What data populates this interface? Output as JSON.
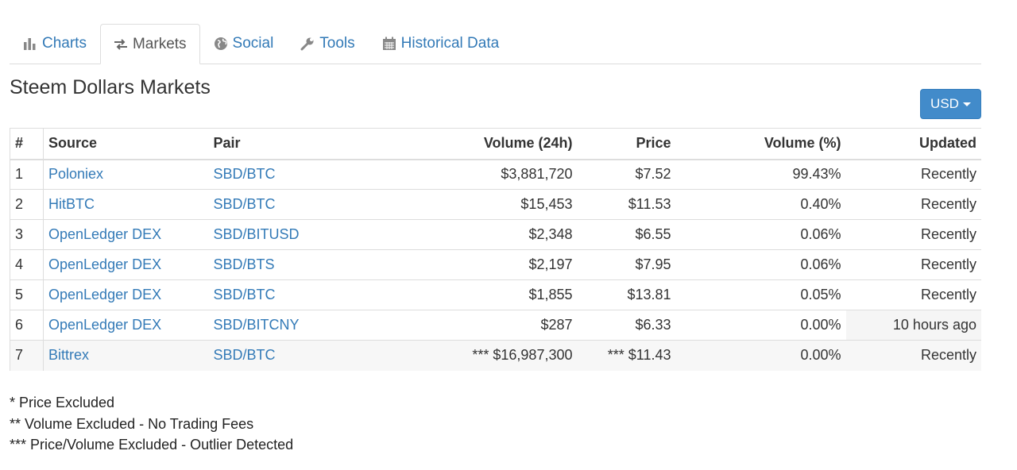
{
  "tabs": [
    {
      "label": "Charts",
      "icon": "bar-chart-icon",
      "active": false
    },
    {
      "label": "Markets",
      "icon": "exchange-arrows-icon",
      "active": true
    },
    {
      "label": "Social",
      "icon": "globe-icon",
      "active": false
    },
    {
      "label": "Tools",
      "icon": "wrench-icon",
      "active": false
    },
    {
      "label": "Historical Data",
      "icon": "calendar-icon",
      "active": false
    }
  ],
  "page_title": "Steem Dollars Markets",
  "currency_dropdown": {
    "label": "USD"
  },
  "table": {
    "headers": [
      "#",
      "Source",
      "Pair",
      "Volume (24h)",
      "Price",
      "Volume (%)",
      "Updated"
    ],
    "rows": [
      {
        "rank": "1",
        "source": "Poloniex",
        "pair": "SBD/BTC",
        "volume": "$3,881,720",
        "price": "$7.52",
        "volume_pct": "99.43%",
        "updated": "Recently"
      },
      {
        "rank": "2",
        "source": "HitBTC",
        "pair": "SBD/BTC",
        "volume": "$15,453",
        "price": "$11.53",
        "volume_pct": "0.40%",
        "updated": "Recently"
      },
      {
        "rank": "3",
        "source": "OpenLedger DEX",
        "pair": "SBD/BITUSD",
        "volume": "$2,348",
        "price": "$6.55",
        "volume_pct": "0.06%",
        "updated": "Recently"
      },
      {
        "rank": "4",
        "source": "OpenLedger DEX",
        "pair": "SBD/BTS",
        "volume": "$2,197",
        "price": "$7.95",
        "volume_pct": "0.06%",
        "updated": "Recently"
      },
      {
        "rank": "5",
        "source": "OpenLedger DEX",
        "pair": "SBD/BTC",
        "volume": "$1,855",
        "price": "$13.81",
        "volume_pct": "0.05%",
        "updated": "Recently"
      },
      {
        "rank": "6",
        "source": "OpenLedger DEX",
        "pair": "SBD/BITCNY",
        "volume": "$287",
        "price": "$6.33",
        "volume_pct": "0.00%",
        "updated": "10 hours ago"
      },
      {
        "rank": "7",
        "source": "Bittrex",
        "pair": "SBD/BTC",
        "volume": "*** $16,987,300",
        "price": "*** $11.43",
        "volume_pct": "0.00%",
        "updated": "Recently"
      }
    ]
  },
  "notes": [
    "* Price Excluded",
    "** Volume Excluded - No Trading Fees",
    "*** Price/Volume Excluded - Outlier Detected"
  ],
  "colors": {
    "link": "#337ab7",
    "button": "#428bca",
    "border": "#dddddd"
  }
}
